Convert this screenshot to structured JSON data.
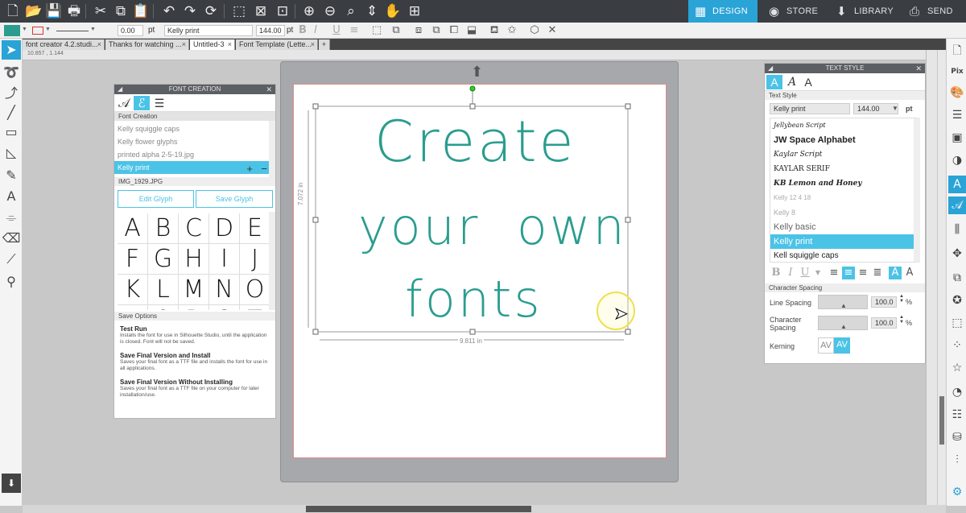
{
  "nav": {
    "design": "DESIGN",
    "store": "STORE",
    "library": "LIBRARY",
    "send": "SEND"
  },
  "toolbar2": {
    "line_width": "0.00",
    "line_unit": "pt",
    "font": "Kelly print",
    "font_size": "144.00",
    "size_unit": "pt"
  },
  "tabs": [
    {
      "label": "font creator 4.2.studi..."
    },
    {
      "label": "Thanks for watching ..."
    },
    {
      "label": "Untitled-3"
    },
    {
      "label": "Font Template (Lette..."
    }
  ],
  "ruler": {
    "coord": "10.857 , 1.144"
  },
  "font_creation": {
    "title": "FONT CREATION",
    "section": "Font Creation",
    "fonts": [
      "Kelly squiggle caps",
      "Kelly flower glyphs",
      "printed alpha 2-5-19.jpg",
      "Kelly print"
    ],
    "selected_index": 3,
    "image_label": "IMG_1929.JPG",
    "edit_glyph": "Edit Glyph",
    "save_glyph": "Save Glyph",
    "glyphs": [
      "A",
      "B",
      "C",
      "D",
      "E",
      "F",
      "G",
      "H",
      "I",
      "J",
      "K",
      "L",
      "M",
      "N",
      "O",
      "P",
      "Q",
      "R",
      "S",
      "T"
    ],
    "save_options": "Save Options",
    "options": [
      {
        "title": "Test Run",
        "desc": "Installs the font for use in Silhouette Studio, until the application is closed. Font will not be saved."
      },
      {
        "title": "Save Final Version and Install",
        "desc": "Saves your final font as a TTF file and installs the font for use in all applications."
      },
      {
        "title": "Save Final Version Without Installing",
        "desc": "Saves your final font as a TTF file on your computer for later installation/use."
      }
    ]
  },
  "canvas": {
    "lines": [
      "Create",
      "your  own",
      "fonts"
    ],
    "text_color": "#2a9d8f",
    "height_label": "7.072 in",
    "width_label": "9.811 in"
  },
  "text_style": {
    "title": "TEXT STYLE",
    "section": "Text Style",
    "font": "Kelly print",
    "size": "144.00",
    "unit": "pt",
    "fonts": [
      "Jellybean Script",
      "JW Space Alphabet",
      "Kaylar Script",
      "KAYLAR SERIF",
      "KB Lemon and Honey",
      "Kelly 12 4 18",
      "Kelly 8",
      "Kelly basic",
      "Kelly print",
      "Kell  squiggle caps"
    ],
    "selected_index": 8,
    "char_spacing": "Character Spacing",
    "line_spacing_label": "Line Spacing",
    "line_spacing": "100.0",
    "char_spacing_label": "Character Spacing",
    "character_spacing": "100.0",
    "pct": "%",
    "kerning_label": "Kerning",
    "kerning_glyph": "AV"
  },
  "colors": {
    "accent": "#2aa3d6",
    "highlight": "#4bc3e6",
    "fill": "#2a9d8f"
  }
}
